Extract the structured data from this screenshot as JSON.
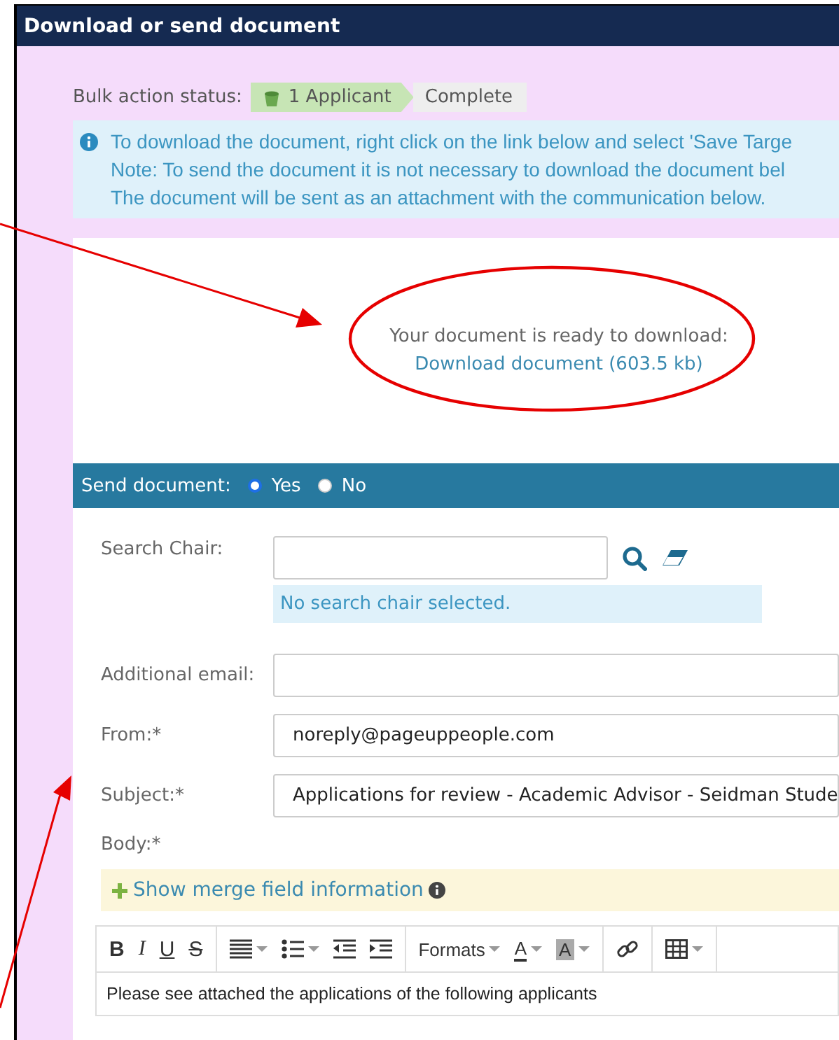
{
  "window": {
    "title": "Download or send document"
  },
  "bulk_status": {
    "label": "Bulk action status:",
    "steps": [
      {
        "text": "1 Applicant",
        "selected": true
      },
      {
        "text": "Complete",
        "selected": false
      }
    ]
  },
  "info": {
    "lines": [
      "To download the document, right click on the link below and select 'Save Targe",
      "Note: To send the document it is not necessary to download the document bel",
      "The document will be sent as an attachment with the communication below."
    ]
  },
  "download": {
    "message": "Your document is ready to download:",
    "link": "Download document (603.5 kb)"
  },
  "send": {
    "label": "Send document:",
    "options": [
      {
        "label": "Yes",
        "selected": true
      },
      {
        "label": "No",
        "selected": false
      }
    ]
  },
  "form": {
    "search_chair": {
      "label": "Search Chair:",
      "status": "No search chair selected."
    },
    "additional_email": {
      "label": "Additional email:"
    },
    "from": {
      "label": "From:*",
      "value": "noreply@pageuppeople.com"
    },
    "subject": {
      "label": "Subject:*",
      "value": "Applications for review - Academic Advisor - Seidman Stude"
    },
    "body": {
      "label": "Body:*",
      "merge_toggle": "Show merge field information",
      "toolbar": [
        [
          {
            "kind": "bold",
            "label": "B"
          },
          {
            "kind": "italic",
            "label": "I"
          },
          {
            "kind": "underline",
            "label": "U"
          },
          {
            "kind": "strike",
            "label": "S"
          }
        ],
        [
          {
            "kind": "align",
            "dropdown": true
          },
          {
            "kind": "bullets",
            "dropdown": true
          },
          {
            "kind": "outdent"
          },
          {
            "kind": "indent"
          }
        ],
        [
          {
            "kind": "formats",
            "label": "Formats",
            "dropdown": true
          },
          {
            "kind": "color",
            "label": "A",
            "dropdown": true
          },
          {
            "kind": "highlight",
            "label": "A",
            "dropdown": true
          }
        ],
        [
          {
            "kind": "link"
          }
        ],
        [
          {
            "kind": "table",
            "dropdown": true
          }
        ]
      ],
      "text": "Please see attached the applications of the following applicants"
    }
  }
}
